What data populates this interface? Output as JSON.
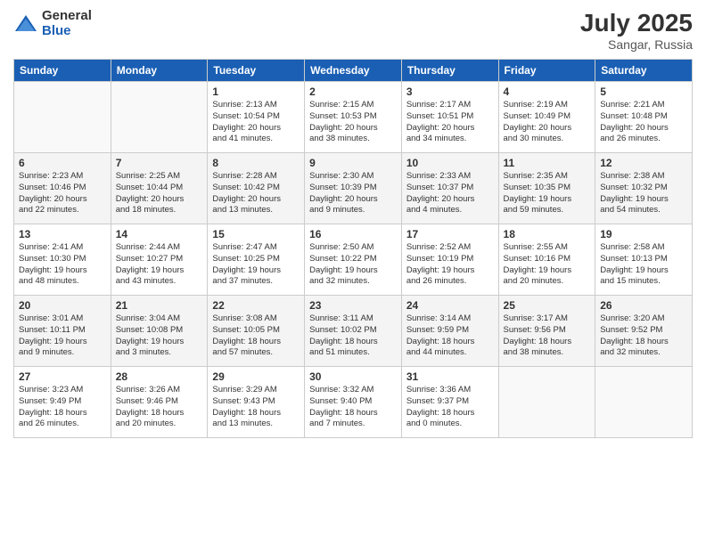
{
  "logo": {
    "general": "General",
    "blue": "Blue"
  },
  "header": {
    "month": "July 2025",
    "location": "Sangar, Russia"
  },
  "weekdays": [
    "Sunday",
    "Monday",
    "Tuesday",
    "Wednesday",
    "Thursday",
    "Friday",
    "Saturday"
  ],
  "weeks": [
    [
      {
        "day": "",
        "detail": ""
      },
      {
        "day": "",
        "detail": ""
      },
      {
        "day": "1",
        "detail": "Sunrise: 2:13 AM\nSunset: 10:54 PM\nDaylight: 20 hours\nand 41 minutes."
      },
      {
        "day": "2",
        "detail": "Sunrise: 2:15 AM\nSunset: 10:53 PM\nDaylight: 20 hours\nand 38 minutes."
      },
      {
        "day": "3",
        "detail": "Sunrise: 2:17 AM\nSunset: 10:51 PM\nDaylight: 20 hours\nand 34 minutes."
      },
      {
        "day": "4",
        "detail": "Sunrise: 2:19 AM\nSunset: 10:49 PM\nDaylight: 20 hours\nand 30 minutes."
      },
      {
        "day": "5",
        "detail": "Sunrise: 2:21 AM\nSunset: 10:48 PM\nDaylight: 20 hours\nand 26 minutes."
      }
    ],
    [
      {
        "day": "6",
        "detail": "Sunrise: 2:23 AM\nSunset: 10:46 PM\nDaylight: 20 hours\nand 22 minutes."
      },
      {
        "day": "7",
        "detail": "Sunrise: 2:25 AM\nSunset: 10:44 PM\nDaylight: 20 hours\nand 18 minutes."
      },
      {
        "day": "8",
        "detail": "Sunrise: 2:28 AM\nSunset: 10:42 PM\nDaylight: 20 hours\nand 13 minutes."
      },
      {
        "day": "9",
        "detail": "Sunrise: 2:30 AM\nSunset: 10:39 PM\nDaylight: 20 hours\nand 9 minutes."
      },
      {
        "day": "10",
        "detail": "Sunrise: 2:33 AM\nSunset: 10:37 PM\nDaylight: 20 hours\nand 4 minutes."
      },
      {
        "day": "11",
        "detail": "Sunrise: 2:35 AM\nSunset: 10:35 PM\nDaylight: 19 hours\nand 59 minutes."
      },
      {
        "day": "12",
        "detail": "Sunrise: 2:38 AM\nSunset: 10:32 PM\nDaylight: 19 hours\nand 54 minutes."
      }
    ],
    [
      {
        "day": "13",
        "detail": "Sunrise: 2:41 AM\nSunset: 10:30 PM\nDaylight: 19 hours\nand 48 minutes."
      },
      {
        "day": "14",
        "detail": "Sunrise: 2:44 AM\nSunset: 10:27 PM\nDaylight: 19 hours\nand 43 minutes."
      },
      {
        "day": "15",
        "detail": "Sunrise: 2:47 AM\nSunset: 10:25 PM\nDaylight: 19 hours\nand 37 minutes."
      },
      {
        "day": "16",
        "detail": "Sunrise: 2:50 AM\nSunset: 10:22 PM\nDaylight: 19 hours\nand 32 minutes."
      },
      {
        "day": "17",
        "detail": "Sunrise: 2:52 AM\nSunset: 10:19 PM\nDaylight: 19 hours\nand 26 minutes."
      },
      {
        "day": "18",
        "detail": "Sunrise: 2:55 AM\nSunset: 10:16 PM\nDaylight: 19 hours\nand 20 minutes."
      },
      {
        "day": "19",
        "detail": "Sunrise: 2:58 AM\nSunset: 10:13 PM\nDaylight: 19 hours\nand 15 minutes."
      }
    ],
    [
      {
        "day": "20",
        "detail": "Sunrise: 3:01 AM\nSunset: 10:11 PM\nDaylight: 19 hours\nand 9 minutes."
      },
      {
        "day": "21",
        "detail": "Sunrise: 3:04 AM\nSunset: 10:08 PM\nDaylight: 19 hours\nand 3 minutes."
      },
      {
        "day": "22",
        "detail": "Sunrise: 3:08 AM\nSunset: 10:05 PM\nDaylight: 18 hours\nand 57 minutes."
      },
      {
        "day": "23",
        "detail": "Sunrise: 3:11 AM\nSunset: 10:02 PM\nDaylight: 18 hours\nand 51 minutes."
      },
      {
        "day": "24",
        "detail": "Sunrise: 3:14 AM\nSunset: 9:59 PM\nDaylight: 18 hours\nand 44 minutes."
      },
      {
        "day": "25",
        "detail": "Sunrise: 3:17 AM\nSunset: 9:56 PM\nDaylight: 18 hours\nand 38 minutes."
      },
      {
        "day": "26",
        "detail": "Sunrise: 3:20 AM\nSunset: 9:52 PM\nDaylight: 18 hours\nand 32 minutes."
      }
    ],
    [
      {
        "day": "27",
        "detail": "Sunrise: 3:23 AM\nSunset: 9:49 PM\nDaylight: 18 hours\nand 26 minutes."
      },
      {
        "day": "28",
        "detail": "Sunrise: 3:26 AM\nSunset: 9:46 PM\nDaylight: 18 hours\nand 20 minutes."
      },
      {
        "day": "29",
        "detail": "Sunrise: 3:29 AM\nSunset: 9:43 PM\nDaylight: 18 hours\nand 13 minutes."
      },
      {
        "day": "30",
        "detail": "Sunrise: 3:32 AM\nSunset: 9:40 PM\nDaylight: 18 hours\nand 7 minutes."
      },
      {
        "day": "31",
        "detail": "Sunrise: 3:36 AM\nSunset: 9:37 PM\nDaylight: 18 hours\nand 0 minutes."
      },
      {
        "day": "",
        "detail": ""
      },
      {
        "day": "",
        "detail": ""
      }
    ]
  ]
}
